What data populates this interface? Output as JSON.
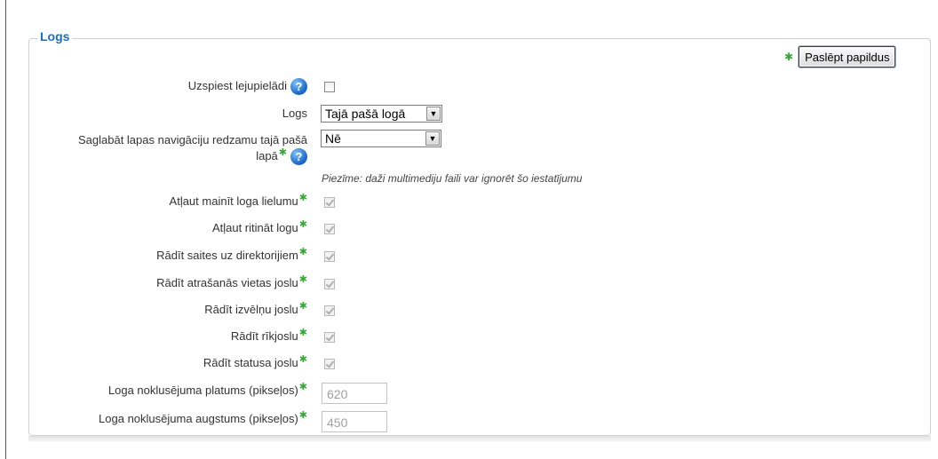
{
  "section": {
    "legend": "Logs",
    "hide_advanced_label": "Paslēpt papildus"
  },
  "fields": {
    "force_download": {
      "label": "Uzspiest lejupielādi",
      "checked": false
    },
    "window": {
      "label": "Logs",
      "value": "Tajā pašā logā"
    },
    "keep_nav": {
      "label_line1": "Saglabāt lapas navigāciju redzamu tajā pašā",
      "label_line2": "lapā",
      "value": "Nē"
    },
    "note": "Piezīme: daži multimediju faili var ignorēt šo iestatījumu",
    "resizable": {
      "label": "Atļaut mainīt loga lielumu",
      "checked": true
    },
    "scrollbars": {
      "label": "Atļaut ritināt logu",
      "checked": true
    },
    "directories": {
      "label": "Rādīt saites uz direktorijiem",
      "checked": true
    },
    "location": {
      "label": "Rādīt atrašanās vietas joslu",
      "checked": true
    },
    "menubar": {
      "label": "Rādīt izvēlņu joslu",
      "checked": true
    },
    "toolbar": {
      "label": "Rādīt rīkjoslu",
      "checked": true
    },
    "status": {
      "label": "Rādīt statusa joslu",
      "checked": true
    },
    "width": {
      "label": "Loga noklusējuma platums (pikseļos)",
      "value": "620"
    },
    "height": {
      "label": "Loga noklusējuma augstums (pikseļos)",
      "value": "450"
    }
  },
  "icons": {
    "help": "help-icon",
    "required": "required-star-icon"
  },
  "colors": {
    "legend": "#1a6ec8",
    "required_star": "#33aa33",
    "help_icon": "#1464c8"
  }
}
